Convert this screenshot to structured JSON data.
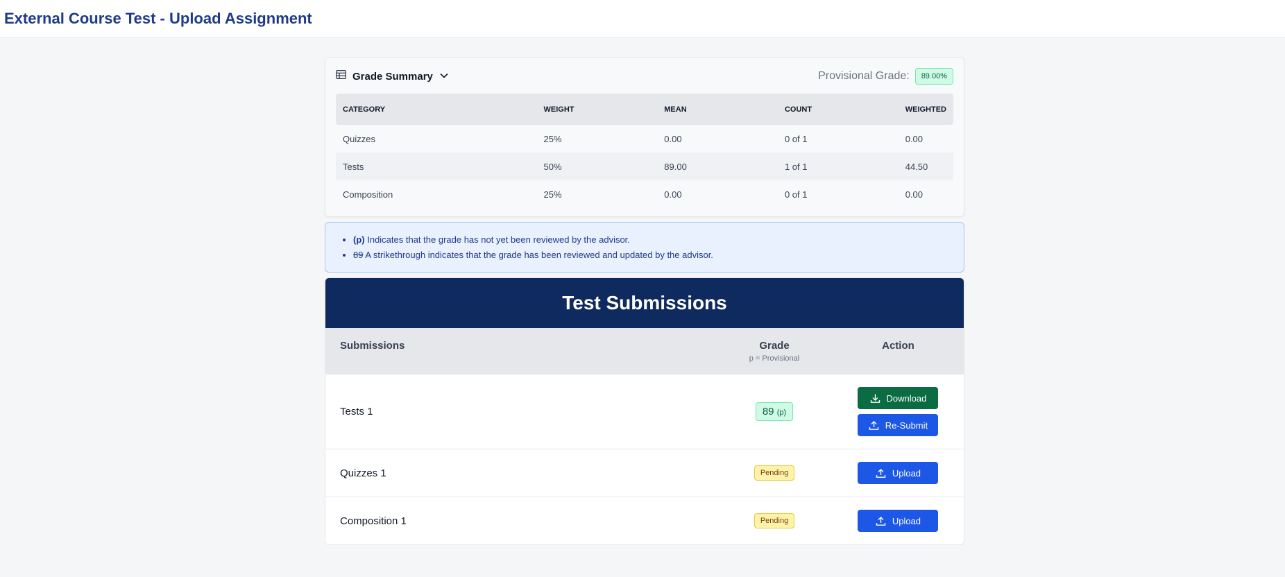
{
  "header": {
    "title": "External Course Test - Upload Assignment"
  },
  "summary": {
    "title": "Grade Summary",
    "icon": "table-icon",
    "toggle_icon": "chevron-down-icon",
    "provisional_label": "Provisional Grade:",
    "provisional_value": "89.00%",
    "columns": [
      "CATEGORY",
      "WEIGHT",
      "MEAN",
      "COUNT",
      "WEIGHTED"
    ],
    "rows": [
      {
        "category": "Quizzes",
        "weight": "25%",
        "mean": "0.00",
        "count": "0 of 1",
        "weighted": "0.00"
      },
      {
        "category": "Tests",
        "weight": "50%",
        "mean": "89.00",
        "count": "1 of 1",
        "weighted": "44.50"
      },
      {
        "category": "Composition",
        "weight": "25%",
        "mean": "0.00",
        "count": "0 of 1",
        "weighted": "0.00"
      }
    ]
  },
  "legend": {
    "items": [
      {
        "marker": "(p)",
        "text": " Indicates that the grade has not yet been reviewed by the advisor."
      },
      {
        "marker": "89",
        "text": " A strikethrough indicates that the grade has been reviewed and updated by the advisor."
      }
    ]
  },
  "submissions": {
    "title": "Test Submissions",
    "col_submissions": "Submissions",
    "col_grade": "Grade",
    "col_grade_note": "p = Provisional",
    "col_action": "Action",
    "rows": [
      {
        "name": "Tests 1",
        "grade": "89",
        "grade_marker": "(p)",
        "download_label": "Download",
        "resubmit_label": "Re-Submit"
      },
      {
        "name": "Quizzes 1",
        "status": "Pending",
        "upload_label": "Upload"
      },
      {
        "name": "Composition 1",
        "status": "Pending",
        "upload_label": "Upload"
      }
    ]
  },
  "colors": {
    "title_blue": "#1e3a8a",
    "header_navy": "#0f2a5e",
    "download_green": "#0b6b43",
    "upload_blue": "#1d57e6",
    "pending_yellow": "#fef3a8",
    "grade_green": "#d1fae5"
  }
}
